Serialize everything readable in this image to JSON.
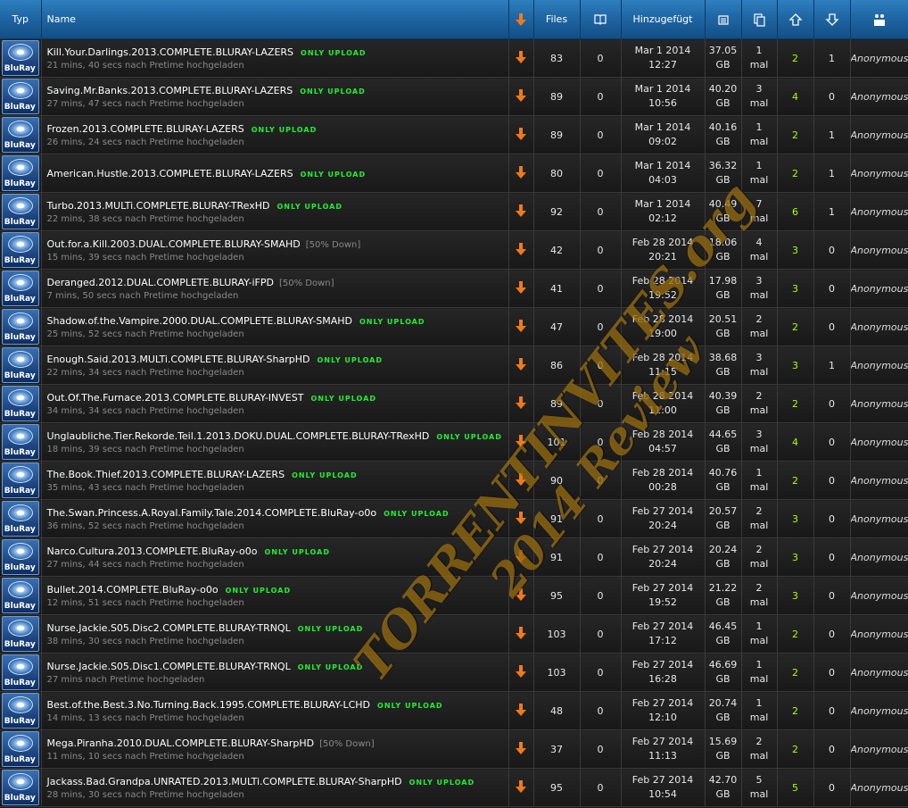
{
  "columns": {
    "typ": "Typ",
    "name": "Name",
    "files": "Files",
    "hinzugefuegt": "Hinzugefügt"
  },
  "header_icons": [
    "download-arrow-icon",
    "comments-icon",
    "size-icon",
    "snatched-icon",
    "seeders-up-icon",
    "leechers-down-icon",
    "uploader-users-icon"
  ],
  "type_badge": {
    "brand": "BluRay"
  },
  "tags": {
    "only_upload": "ONLY UPLOAD"
  },
  "colors": {
    "header": "#1f66a4",
    "seed": "#aaff00",
    "only_tag": "#22ee33",
    "download": "#f07a1a",
    "watermark": "#d2961a"
  },
  "watermark": {
    "line1": "TORRENTINVITES.org",
    "line2": "2014 Review"
  },
  "rows": [
    {
      "name": "Kill.Your.Darlings.2013.COMPLETE.BLURAY-LAZERS",
      "tag": "ONLY UPLOAD",
      "sub": "21 mins, 40 secs nach Pretime hochgeladen",
      "files": "83",
      "comments": "0",
      "date": "Mar 1 2014",
      "time": "12:27",
      "size": "37.05",
      "unit": "GB",
      "snatched": "1",
      "mal": "mal",
      "seeders": "2",
      "leechers": "1",
      "uploader": "Anonymous"
    },
    {
      "name": "Saving.Mr.Banks.2013.COMPLETE.BLURAY-LAZERS",
      "tag": "ONLY UPLOAD",
      "sub": "27 mins, 47 secs nach Pretime hochgeladen",
      "files": "89",
      "comments": "0",
      "date": "Mar 1 2014",
      "time": "10:56",
      "size": "40.20",
      "unit": "GB",
      "snatched": "3",
      "mal": "mal",
      "seeders": "4",
      "leechers": "0",
      "uploader": "Anonymous"
    },
    {
      "name": "Frozen.2013.COMPLETE.BLURAY-LAZERS",
      "tag": "ONLY UPLOAD",
      "sub": "26 mins, 24 secs nach Pretime hochgeladen",
      "files": "89",
      "comments": "0",
      "date": "Mar 1 2014",
      "time": "09:02",
      "size": "40.16",
      "unit": "GB",
      "snatched": "1",
      "mal": "mal",
      "seeders": "2",
      "leechers": "1",
      "uploader": "Anonymous"
    },
    {
      "name": "American.Hustle.2013.COMPLETE.BLURAY-LAZERS",
      "tag": "ONLY UPLOAD",
      "sub": "",
      "files": "80",
      "comments": "0",
      "date": "Mar 1 2014",
      "time": "04:03",
      "size": "36.32",
      "unit": "GB",
      "snatched": "1",
      "mal": "mal",
      "seeders": "2",
      "leechers": "1",
      "uploader": "Anonymous"
    },
    {
      "name": "Turbo.2013.MULTi.COMPLETE.BLURAY-TRexHD",
      "tag": "ONLY UPLOAD",
      "sub": "22 mins, 38 secs nach Pretime hochgeladen",
      "files": "92",
      "comments": "0",
      "date": "Mar 1 2014",
      "time": "02:12",
      "size": "40.49",
      "unit": "GB",
      "snatched": "7",
      "mal": "mal",
      "seeders": "6",
      "leechers": "1",
      "uploader": "Anonymous"
    },
    {
      "name": "Out.for.a.Kill.2003.DUAL.COMPLETE.BLURAY-SMAHD",
      "tag": "[50% Down]",
      "sub": "15 mins, 39 secs nach Pretime hochgeladen",
      "files": "42",
      "comments": "0",
      "date": "Feb 28 2014",
      "time": "20:21",
      "size": "18.06",
      "unit": "GB",
      "snatched": "4",
      "mal": "mal",
      "seeders": "3",
      "leechers": "0",
      "uploader": "Anonymous"
    },
    {
      "name": "Deranged.2012.DUAL.COMPLETE.BLURAY-iFPD",
      "tag": "[50% Down]",
      "sub": "7 mins, 50 secs nach Pretime hochgeladen",
      "files": "41",
      "comments": "0",
      "date": "Feb 28 2014",
      "time": "19:52",
      "size": "17.98",
      "unit": "GB",
      "snatched": "3",
      "mal": "mal",
      "seeders": "3",
      "leechers": "0",
      "uploader": "Anonymous"
    },
    {
      "name": "Shadow.of.the.Vampire.2000.DUAL.COMPLETE.BLURAY-SMAHD",
      "tag": "ONLY UPLOAD",
      "sub": "25 mins, 52 secs nach Pretime hochgeladen",
      "files": "47",
      "comments": "0",
      "date": "Feb 28 2014",
      "time": "19:00",
      "size": "20.51",
      "unit": "GB",
      "snatched": "2",
      "mal": "mal",
      "seeders": "2",
      "leechers": "0",
      "uploader": "Anonymous"
    },
    {
      "name": "Enough.Said.2013.MULTi.COMPLETE.BLURAY-SharpHD",
      "tag": "ONLY UPLOAD",
      "sub": "22 mins, 34 secs nach Pretime hochgeladen",
      "files": "86",
      "comments": "0",
      "date": "Feb 28 2014",
      "time": "11:15",
      "size": "38.68",
      "unit": "GB",
      "snatched": "3",
      "mal": "mal",
      "seeders": "3",
      "leechers": "1",
      "uploader": "Anonymous"
    },
    {
      "name": "Out.Of.The.Furnace.2013.COMPLETE.BLURAY-INVEST",
      "tag": "ONLY UPLOAD",
      "sub": "34 mins, 34 secs nach Pretime hochgeladen",
      "files": "89",
      "comments": "0",
      "date": "Feb 28 2014",
      "time": "11:00",
      "size": "40.39",
      "unit": "GB",
      "snatched": "2",
      "mal": "mal",
      "seeders": "2",
      "leechers": "0",
      "uploader": "Anonymous"
    },
    {
      "name": "Unglaubliche.Tier.Rekorde.Teil.1.2013.DOKU.DUAL.COMPLETE.BLURAY-TRexHD",
      "tag": "ONLY UPLOAD",
      "sub": "18 mins, 39 secs nach Pretime hochgeladen",
      "files": "101",
      "comments": "0",
      "date": "Feb 28 2014",
      "time": "04:57",
      "size": "44.65",
      "unit": "GB",
      "snatched": "3",
      "mal": "mal",
      "seeders": "4",
      "leechers": "0",
      "uploader": "Anonymous"
    },
    {
      "name": "The.Book.Thief.2013.COMPLETE.BLURAY-LAZERS",
      "tag": "ONLY UPLOAD",
      "sub": "35 mins, 43 secs nach Pretime hochgeladen",
      "files": "90",
      "comments": "0",
      "date": "Feb 28 2014",
      "time": "00:28",
      "size": "40.76",
      "unit": "GB",
      "snatched": "1",
      "mal": "mal",
      "seeders": "2",
      "leechers": "0",
      "uploader": "Anonymous"
    },
    {
      "name": "The.Swan.Princess.A.Royal.Family.Tale.2014.COMPLETE.BluRay-o0o",
      "tag": "ONLY UPLOAD",
      "sub": "36 mins, 52 secs nach Pretime hochgeladen",
      "files": "91",
      "comments": "0",
      "date": "Feb 27 2014",
      "time": "20:24",
      "size": "20.57",
      "unit": "GB",
      "snatched": "2",
      "mal": "mal",
      "seeders": "3",
      "leechers": "0",
      "uploader": "Anonymous"
    },
    {
      "name": "Narco.Cultura.2013.COMPLETE.BluRay-o0o",
      "tag": "ONLY UPLOAD",
      "sub": "27 mins, 44 secs nach Pretime hochgeladen",
      "files": "91",
      "comments": "0",
      "date": "Feb 27 2014",
      "time": "20:24",
      "size": "20.24",
      "unit": "GB",
      "snatched": "2",
      "mal": "mal",
      "seeders": "3",
      "leechers": "0",
      "uploader": "Anonymous"
    },
    {
      "name": "Bullet.2014.COMPLETE.BluRay-o0o",
      "tag": "ONLY UPLOAD",
      "sub": "12 mins, 51 secs nach Pretime hochgeladen",
      "files": "95",
      "comments": "0",
      "date": "Feb 27 2014",
      "time": "19:52",
      "size": "21.22",
      "unit": "GB",
      "snatched": "2",
      "mal": "mal",
      "seeders": "3",
      "leechers": "0",
      "uploader": "Anonymous"
    },
    {
      "name": "Nurse.Jackie.S05.Disc2.COMPLETE.BLURAY-TRNQL",
      "tag": "ONLY UPLOAD",
      "sub": "38 mins, 30 secs nach Pretime hochgeladen",
      "files": "103",
      "comments": "0",
      "date": "Feb 27 2014",
      "time": "17:12",
      "size": "46.45",
      "unit": "GB",
      "snatched": "1",
      "mal": "mal",
      "seeders": "2",
      "leechers": "0",
      "uploader": "Anonymous"
    },
    {
      "name": "Nurse.Jackie.S05.Disc1.COMPLETE.BLURAY-TRNQL",
      "tag": "ONLY UPLOAD",
      "sub": "27 mins nach Pretime hochgeladen",
      "files": "103",
      "comments": "0",
      "date": "Feb 27 2014",
      "time": "16:28",
      "size": "46.69",
      "unit": "GB",
      "snatched": "1",
      "mal": "mal",
      "seeders": "2",
      "leechers": "0",
      "uploader": "Anonymous"
    },
    {
      "name": "Best.of.the.Best.3.No.Turning.Back.1995.COMPLETE.BLURAY-LCHD",
      "tag": "ONLY UPLOAD",
      "sub": "14 mins, 13 secs nach Pretime hochgeladen",
      "files": "48",
      "comments": "0",
      "date": "Feb 27 2014",
      "time": "12:10",
      "size": "20.74",
      "unit": "GB",
      "snatched": "1",
      "mal": "mal",
      "seeders": "2",
      "leechers": "0",
      "uploader": "Anonymous"
    },
    {
      "name": "Mega.Piranha.2010.DUAL.COMPLETE.BLURAY-SharpHD",
      "tag": "[50% Down]",
      "sub": "11 mins, 10 secs nach Pretime hochgeladen",
      "files": "37",
      "comments": "0",
      "date": "Feb 27 2014",
      "time": "11:13",
      "size": "15.69",
      "unit": "GB",
      "snatched": "2",
      "mal": "mal",
      "seeders": "2",
      "leechers": "0",
      "uploader": "Anonymous"
    },
    {
      "name": "Jackass.Bad.Grandpa.UNRATED.2013.MULTi.COMPLETE.BLURAY-SharpHD",
      "tag": "ONLY UPLOAD",
      "sub": "28 mins, 30 secs nach Pretime hochgeladen",
      "files": "95",
      "comments": "0",
      "date": "Feb 27 2014",
      "time": "10:54",
      "size": "42.70",
      "unit": "GB",
      "snatched": "5",
      "mal": "mal",
      "seeders": "5",
      "leechers": "0",
      "uploader": "Anonymous"
    }
  ]
}
